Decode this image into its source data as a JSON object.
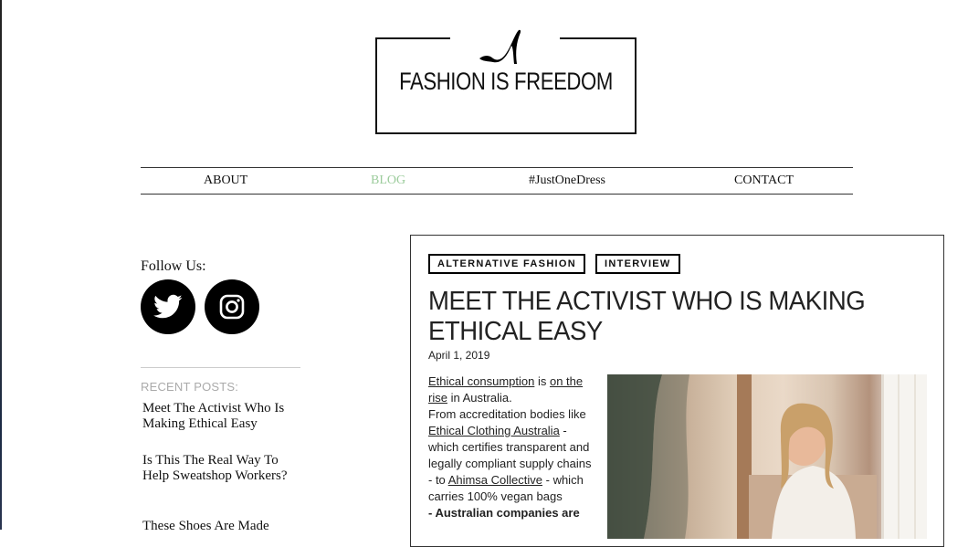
{
  "site": {
    "title": "FASHION IS FREEDOM"
  },
  "nav": {
    "items": [
      {
        "label": "ABOUT",
        "active": false
      },
      {
        "label": "BLOG",
        "active": true
      },
      {
        "label": "#JustOneDress",
        "active": false
      },
      {
        "label": "CONTACT",
        "active": false
      }
    ]
  },
  "sidebar": {
    "follow_label": "Follow Us:",
    "social": [
      {
        "icon": "twitter-icon"
      },
      {
        "icon": "instagram-icon"
      }
    ],
    "recent_label": "RECENT POSTS:",
    "recent_posts": [
      "Meet The Activist Who Is Making Ethical Easy",
      "Is This The Real Way To Help Sweatshop Workers?",
      "These Shoes Are Made"
    ]
  },
  "article": {
    "tags": [
      "ALTERNATIVE FASHION",
      "INTERVIEW"
    ],
    "title": "MEET THE ACTIVIST WHO IS MAKING ETHICAL EASY",
    "date": "April 1, 2019",
    "body": {
      "link1": "Ethical consumption",
      "t1": " is ",
      "link2": "on the rise",
      "t2": " in Australia.",
      "t3": "From accreditation bodies like ",
      "link3": "Ethical Clothing Australia",
      "t4": " - which certifies transparent and legally compliant supply chains - to ",
      "link4": "Ahimsa Collective",
      "t5": " - which carries 100% vegan bags",
      "t6": "- Australian companies are"
    },
    "photo_alt": "woman-smiling-photo"
  },
  "colors": {
    "active_nav": "#9ccc9c",
    "recent_label": "#aaaaaa"
  }
}
